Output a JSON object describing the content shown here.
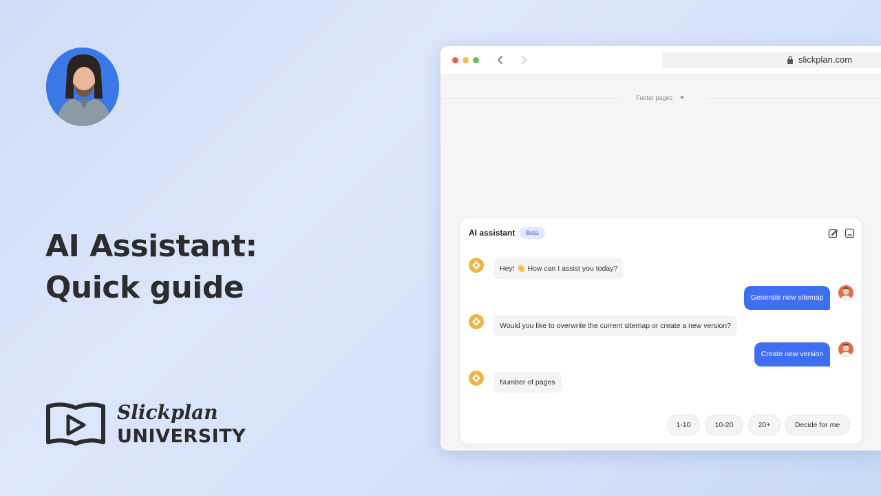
{
  "headline": {
    "line1": "AI Assistant:",
    "line2": "Quick guide"
  },
  "brand": {
    "script_name": "Slickplan",
    "subtitle": "UNIVERSITY",
    "logo_icon": "open-book-play-icon"
  },
  "browser": {
    "url": "slickplan.com",
    "lock_icon": "lock-icon",
    "back_icon": "chevron-left-icon",
    "forward_icon": "chevron-right-icon",
    "window_controls": {
      "close": "#ed5f56",
      "minimize": "#f4be4f",
      "maximize": "#5fc454"
    }
  },
  "canvas": {
    "section_label": "Footer pages"
  },
  "assistant": {
    "title": "AI assistant",
    "badge": "Beta",
    "accent_color": "#3f6ff0",
    "bot_avatar_color": "#e8b84a",
    "edit_icon": "edit-icon",
    "minimize_icon": "minimize-icon",
    "messages": [
      {
        "sender": "bot",
        "text": "Hey! 👋 How can I assist you today?"
      },
      {
        "sender": "user",
        "text": "Generate new sitemap"
      },
      {
        "sender": "bot",
        "text": "Would you like to overwrite the current sitemap or create a new version?"
      },
      {
        "sender": "user",
        "text": "Create new version"
      },
      {
        "sender": "bot",
        "text": "Number of pages"
      }
    ],
    "options": [
      "1-10",
      "10-20",
      "20+",
      "Decide for me"
    ]
  }
}
